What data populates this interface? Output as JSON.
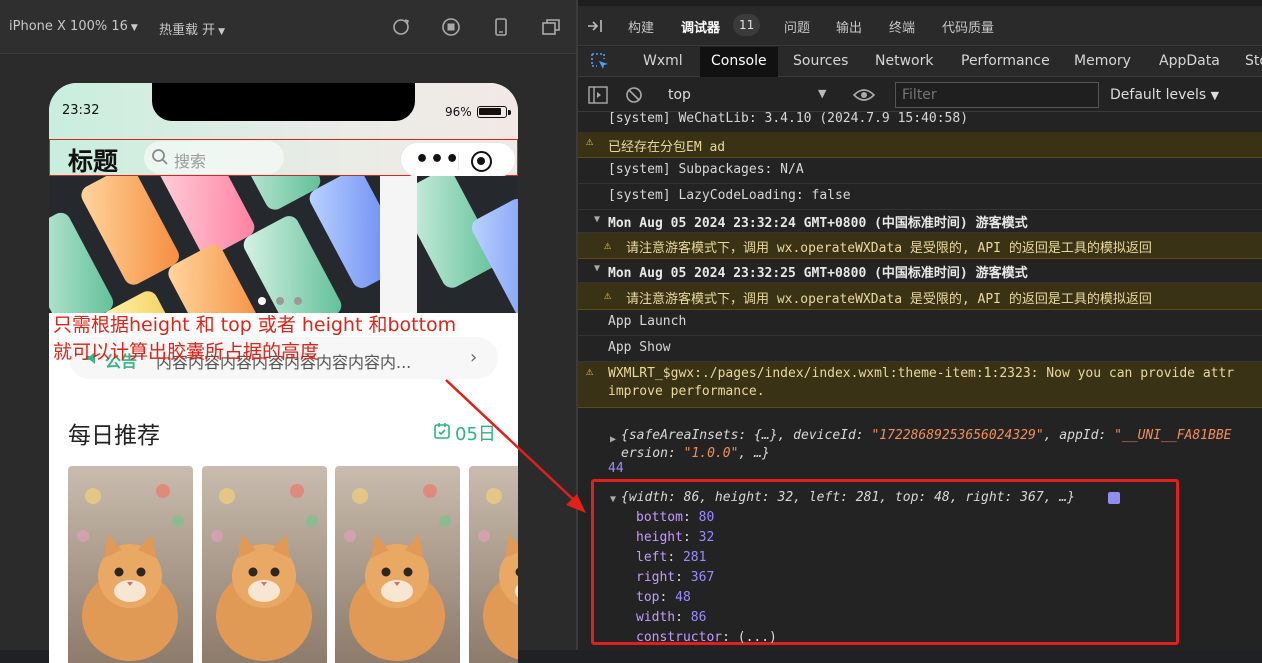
{
  "simulator": {
    "device_label": "iPhone X 100% 16",
    "hot_reload_label": "热重载 开",
    "status_time": "23:32",
    "battery_percent": "96%",
    "nav_title": "标题",
    "search_placeholder": "搜索",
    "banner_active_dot": 1,
    "banner_dot_count": 3,
    "annotation_line1": "只需根据height 和 top 或者 height 和bottom",
    "annotation_line2": "就可以计算出胶囊所占据的高度",
    "notice_label": "公告",
    "notice_text": "内容内容内容内容内容内容内容内...",
    "daily_title": "每日推荐",
    "daily_date": "05日",
    "colors": {
      "accent_green": "#2db482",
      "annotation_red": "#d9261c"
    }
  },
  "devtools": {
    "top_tabs": [
      "构建",
      "调试器",
      "问题",
      "输出",
      "终端",
      "代码质量"
    ],
    "badge": "11",
    "panel_tabs": [
      "Wxml",
      "Console",
      "Sources",
      "Network",
      "Performance",
      "Memory",
      "AppData",
      "Sto"
    ],
    "context": "top",
    "filter_placeholder": "Filter",
    "levels": "Default levels",
    "console": {
      "l1": "[system] WeChatLib: 3.4.10 (2024.7.9 15:40:58)",
      "l2": "已经存在分包EM ad",
      "l3": "[system] Subpackages: N/A",
      "l4": "[system] LazyCodeLoading: false",
      "l5": "Mon Aug 05 2024 23:32:24 GMT+0800 (中国标准时间) 游客模式",
      "l6": "请注意游客模式下，调用 wx.operateWXData 是受限的, API 的返回是工具的模拟返回",
      "l7": "Mon Aug 05 2024 23:32:25 GMT+0800 (中国标准时间) 游客模式",
      "l8": "请注意游客模式下，调用 wx.operateWXData 是受限的, API 的返回是工具的模拟返回",
      "l9": "App Launch",
      "l10": "App Show",
      "l11a": "WXMLRT_$gwx:./pages/index/index.wxml:theme-item:1:2323: Now you can provide attr",
      "l11b": "improve performance.",
      "obj1_a": "{safeAreaInsets: {…}, deviceId: ",
      "obj1_b": "\"17228689253656024329\"",
      "obj1_c": ", appId: ",
      "obj1_d": "\"__UNI__FA81BBE",
      "obj1_e": "ersion: ",
      "obj1_f": "\"1.0.0\"",
      "obj1_g": ", …}",
      "num44": "44",
      "obj2_summary": "{width: 86, height: 32, left: 281, top: 48, right: 367, …}",
      "props": [
        {
          "k": "bottom",
          "v": "80"
        },
        {
          "k": "height",
          "v": "32"
        },
        {
          "k": "left",
          "v": "281"
        },
        {
          "k": "right",
          "v": "367"
        },
        {
          "k": "top",
          "v": "48"
        },
        {
          "k": "width",
          "v": "86"
        },
        {
          "k": "constructor",
          "v": "(...)"
        }
      ]
    }
  }
}
